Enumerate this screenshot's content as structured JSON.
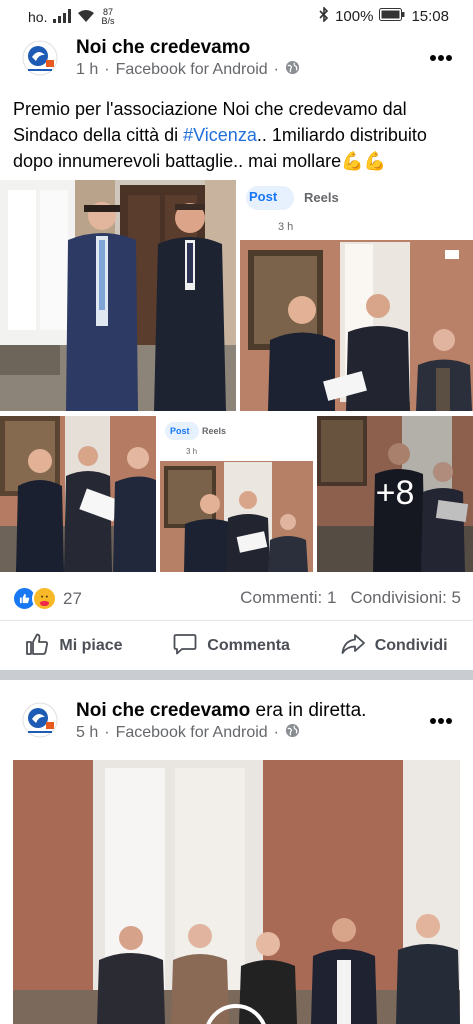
{
  "status": {
    "carrier": "ho.",
    "speed_value": "87",
    "speed_unit": "B/s",
    "battery": "100%",
    "time": "15:08"
  },
  "post1": {
    "page_name": "Noi che credevamo",
    "time": "1 h",
    "source": "Facebook for Android",
    "caption_before": "Premio per l'associazione Noi che credevamo dal Sindaco della città di ",
    "hashtag": "#Vicenza",
    "caption_after": ".. 1miliardo distribuito dopo innumerevoli battaglie.. mai mollare",
    "caption_emoji": "💪💪",
    "embedded_tab_post": "Post",
    "embedded_tab_reels": "Reels",
    "embedded_time": "3 h",
    "more_photos": "+8",
    "reaction_count": "27",
    "comments": "Commenti: 1",
    "shares": "Condivisioni: 5",
    "like_label": "Mi piace",
    "comment_label": "Commenta",
    "share_label": "Condividi"
  },
  "post2": {
    "page_name": "Noi che credevamo",
    "activity": "era in diretta.",
    "time": "5 h",
    "source": "Facebook for Android"
  },
  "icons": [
    "signal-icon",
    "wifi-icon",
    "bluetooth-icon",
    "battery-icon",
    "globe-icon",
    "more-icon",
    "like-icon",
    "care-icon",
    "thumb-up-icon",
    "comment-icon",
    "share-icon"
  ],
  "colors": {
    "link": "#216fdb",
    "like_blue": "#1877f2",
    "care_yellow": "#f7b928",
    "muted": "#65676b"
  }
}
